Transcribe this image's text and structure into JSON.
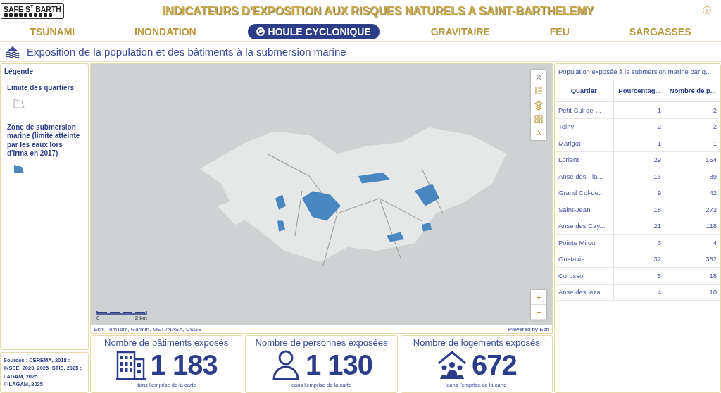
{
  "header": {
    "logo": "SAFE S$^{T}$ BARTH",
    "title": "INDICATEURS D'EXPOSITION AUX RISQUES NATURELS A SAINT-BARTHELEMY",
    "info": "ⓘ"
  },
  "tabs": [
    {
      "label": "TSUNAMI",
      "selected": false
    },
    {
      "label": "INONDATION",
      "selected": false
    },
    {
      "label": "HOULE CYCLONIQUE",
      "selected": true
    },
    {
      "label": "GRAVITAIRE",
      "selected": false
    },
    {
      "label": "FEU",
      "selected": false
    },
    {
      "label": "SARGASSES",
      "selected": false
    }
  ],
  "section_title": "Exposition de la population et des bâtiments à la submersion marine",
  "legend": {
    "title": "Légende",
    "items": [
      {
        "label": "Limite des quartiers",
        "kind": "outline"
      },
      {
        "label": "Zone de submersion marine (limite atteinte par les eaux lors d'Irma en 2017)",
        "kind": "filled"
      }
    ]
  },
  "sources": [
    "Sources : CEREMA, 2018 : INSEE, 2020, 2025 ;STIS, 2025 ; LAGAM, 2025",
    "© LAGAM, 2025"
  ],
  "map": {
    "kind": "picture",
    "scale_labels": [
      "0",
      "2 km"
    ],
    "attribution": "Esri, TomTom, Garmin, METI/NASA, USGS",
    "powered_by": "Powered by Esri",
    "zoom_in": "+",
    "zoom_out": "−"
  },
  "table": {
    "title": "Population exposée à la submersion marine par q...",
    "columns": [
      "Quartier",
      "Pourcentag...",
      "Nombre de p..."
    ],
    "rows": [
      [
        "Petit Cul-de-...",
        "1",
        "2"
      ],
      [
        "Toiny",
        "2",
        "2"
      ],
      [
        "Marigot",
        "1",
        "1"
      ],
      [
        "Lorient",
        "29",
        "154"
      ],
      [
        "Anse des Fla...",
        "16",
        "89"
      ],
      [
        "Grand Cul-de...",
        "9",
        "42"
      ],
      [
        "Saint-Jean",
        "18",
        "272"
      ],
      [
        "Anse des Cay...",
        "21",
        "118"
      ],
      [
        "Pointe Milou",
        "3",
        "4"
      ],
      [
        "Gustavia",
        "32",
        "382"
      ],
      [
        "Corossol",
        "5",
        "18"
      ],
      [
        "Anse des leza...",
        "4",
        "10"
      ]
    ]
  },
  "stats": [
    {
      "title": "Nombre de bâtiments exposés",
      "value": "1 183",
      "caption": "dans l'emprise de la carte",
      "kind": "building"
    },
    {
      "title": "Nombre de personnes exposées",
      "value": "1 130",
      "caption": "dans l'emprise de la carte",
      "kind": "person"
    },
    {
      "title": "Nombre de logements exposés",
      "value": "672",
      "caption": "dans l'emprise de la carte",
      "kind": "house"
    }
  ]
}
